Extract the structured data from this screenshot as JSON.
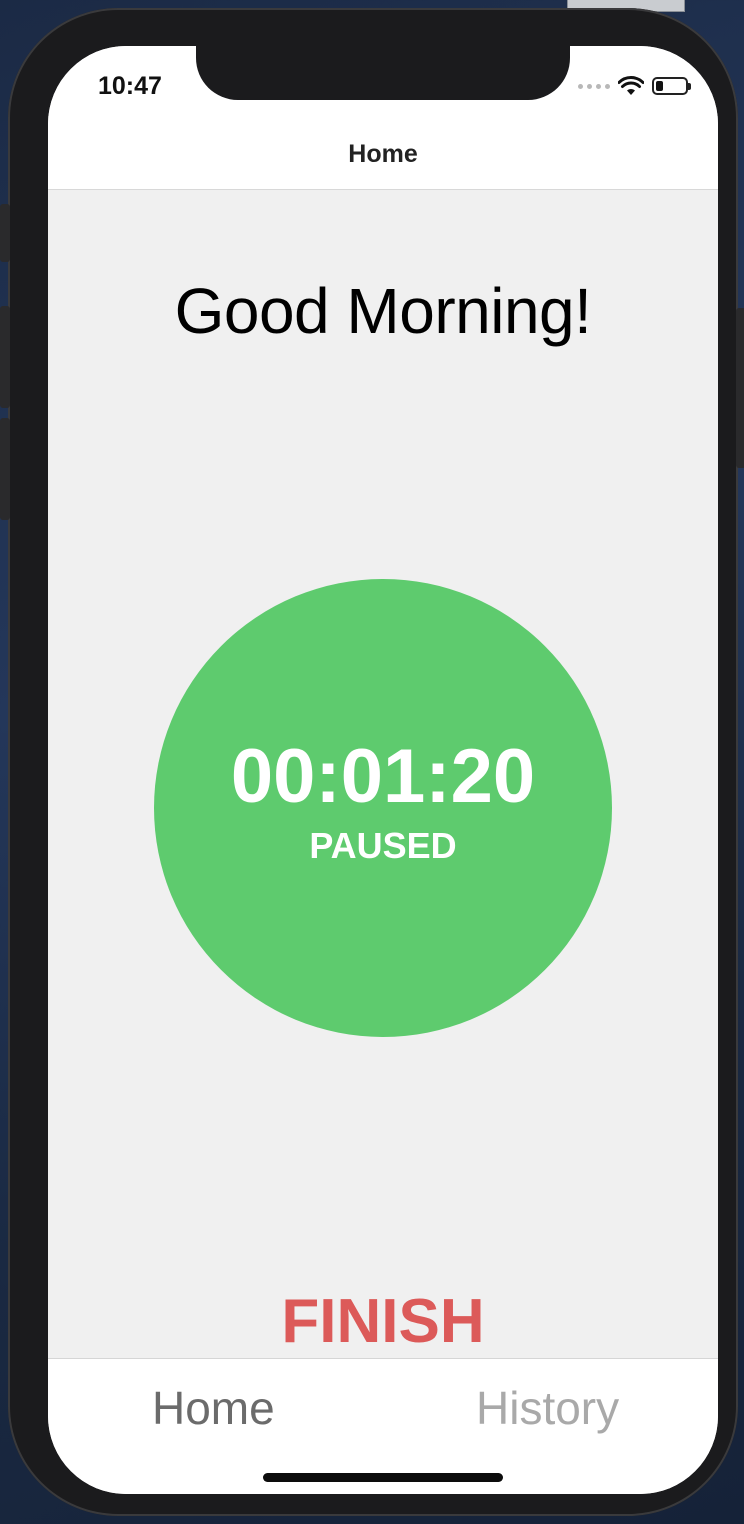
{
  "status_bar": {
    "time": "10:47",
    "battery_level": 0.25,
    "icons": [
      "signal-dots-icon",
      "wifi-icon",
      "battery-icon"
    ]
  },
  "nav": {
    "title": "Home"
  },
  "greeting": "Good Morning!",
  "timer": {
    "value": "00:01:20",
    "state": "PAUSED",
    "color": "#5ecb6e"
  },
  "finish": {
    "label": "FINISH",
    "color": "#dc5a59"
  },
  "tabs": [
    {
      "label": "Home",
      "active": true
    },
    {
      "label": "History",
      "active": false
    }
  ]
}
